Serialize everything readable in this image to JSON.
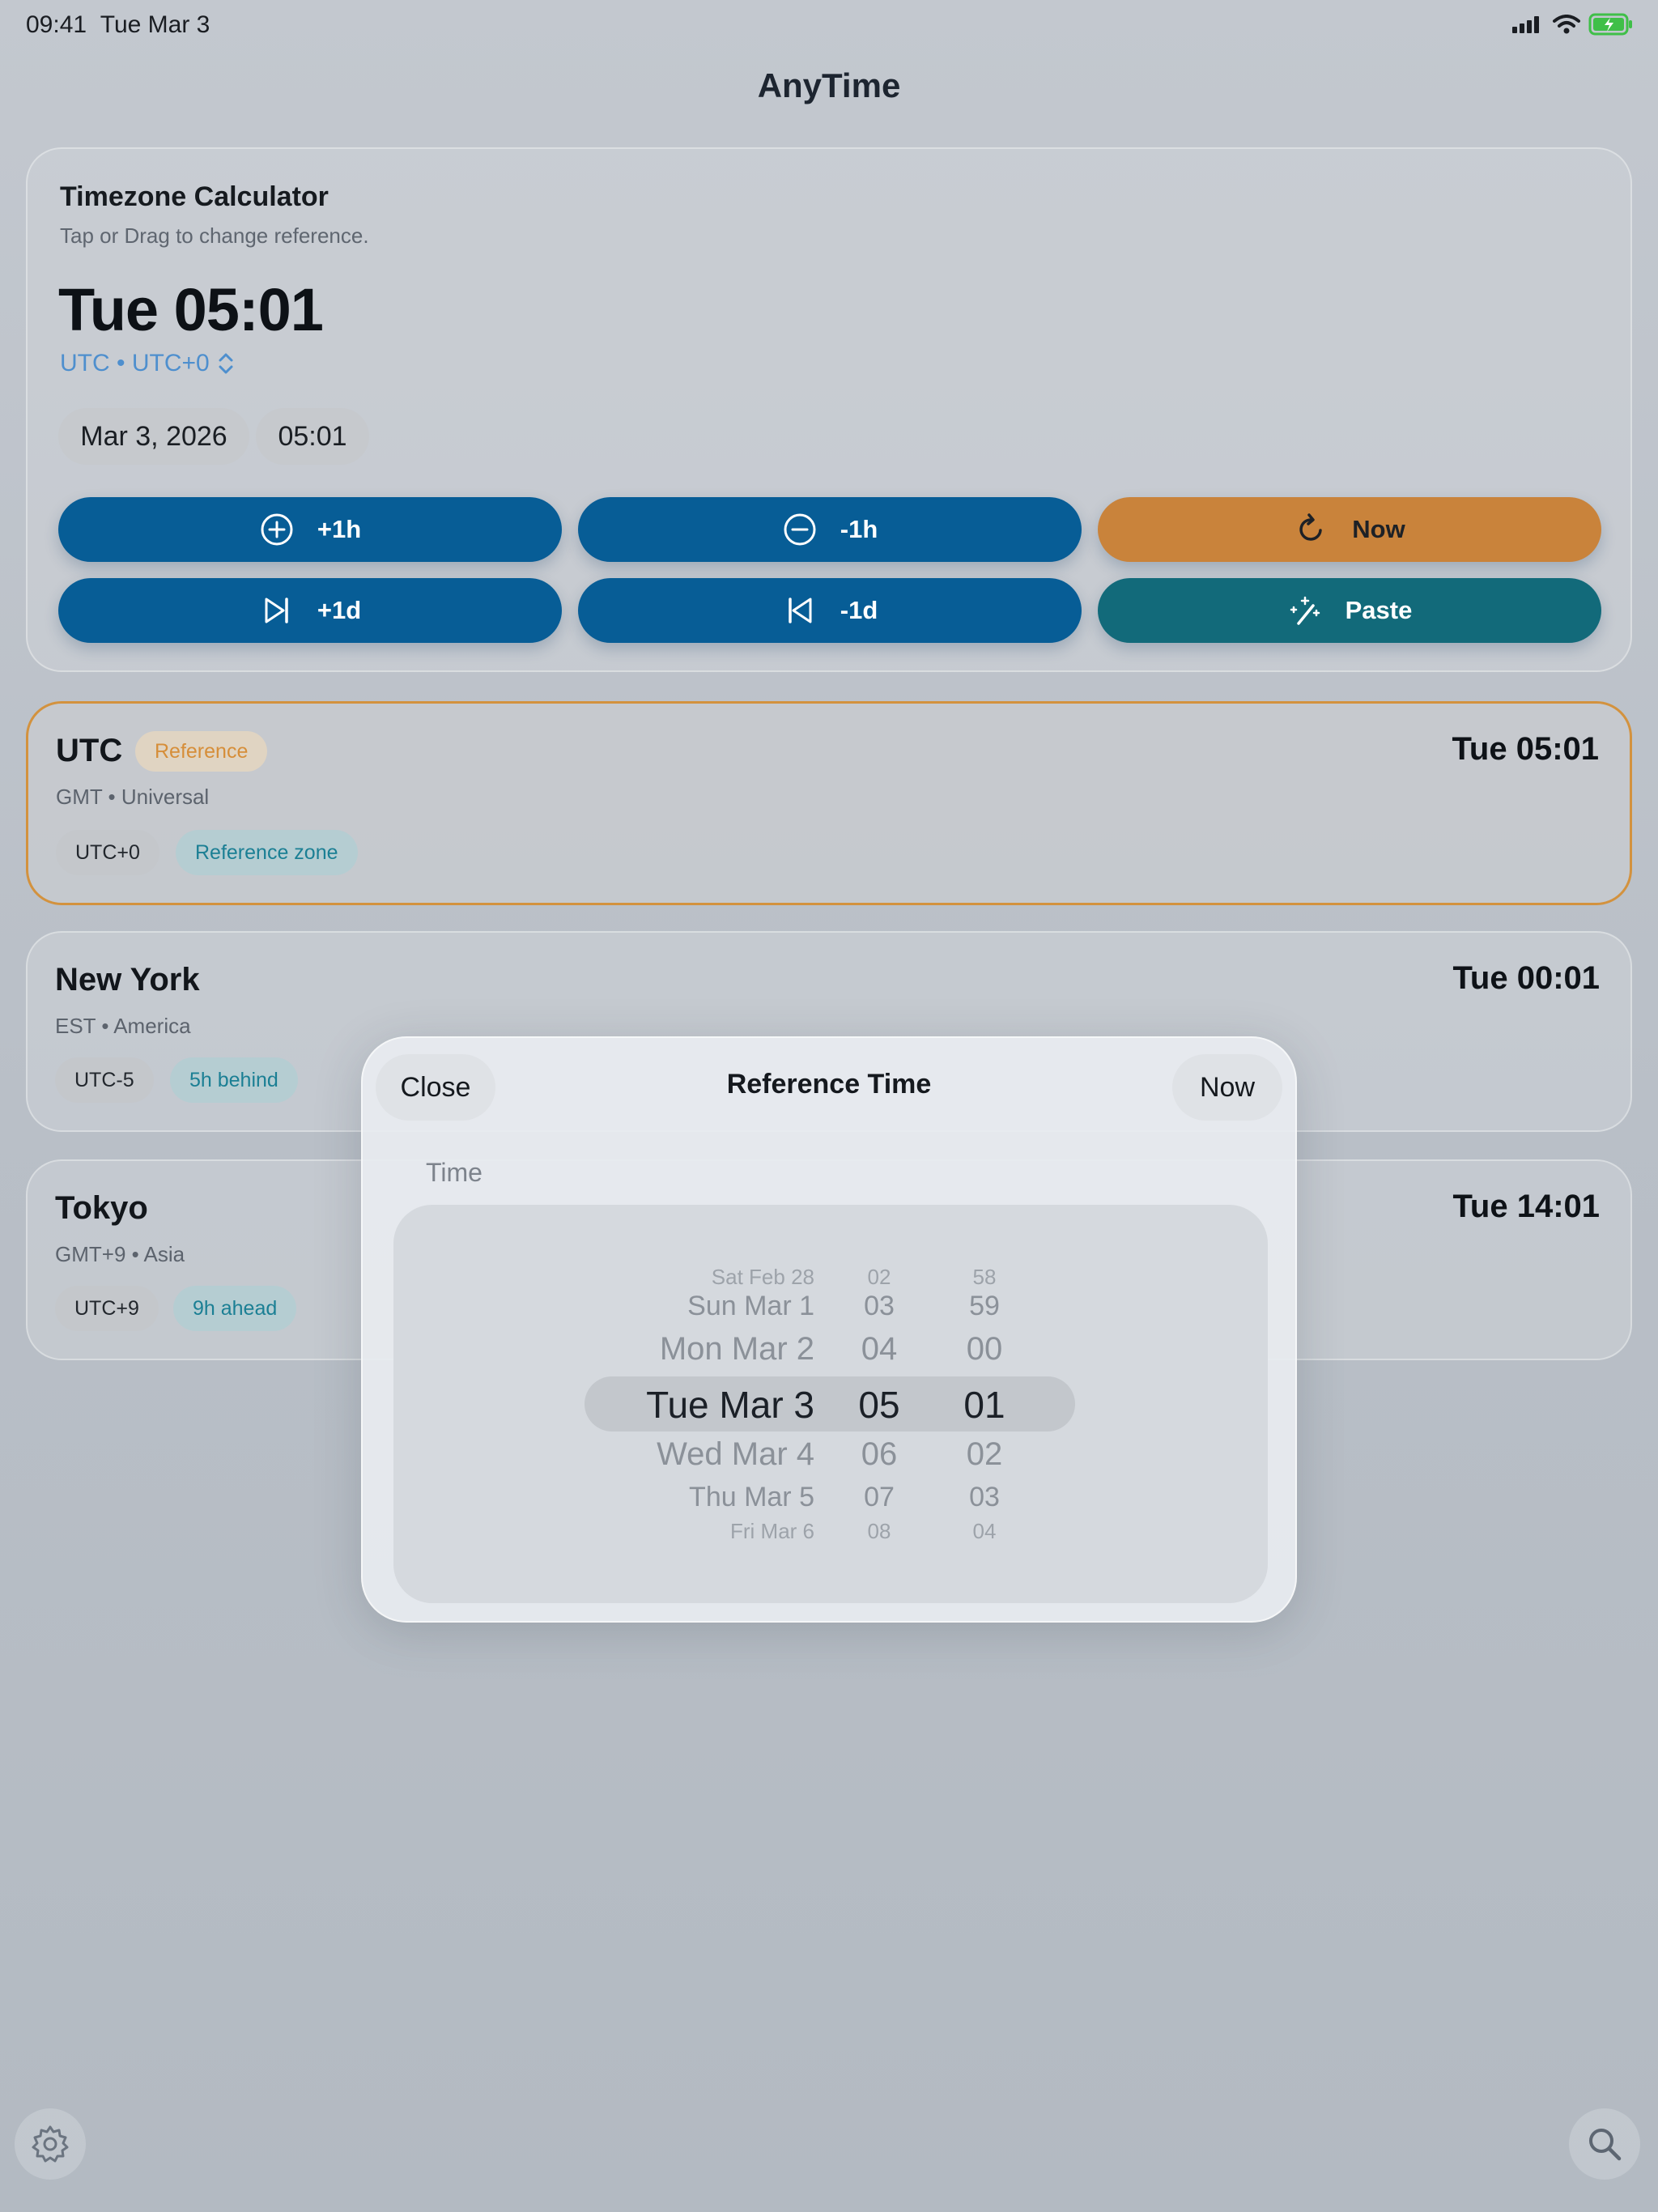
{
  "status_bar": {
    "time": "09:41",
    "date": "Tue Mar 3"
  },
  "app": {
    "title": "AnyTime"
  },
  "calculator": {
    "title": "Timezone Calculator",
    "subtitle": "Tap or Drag to change reference.",
    "big_time": "Tue 05:01",
    "timezone_label": "UTC • UTC+0",
    "date_value": "Mar 3, 2026",
    "time_value": "05:01",
    "buttons": {
      "plus_hour": "+1h",
      "minus_hour": "-1h",
      "now": "Now",
      "plus_day": "+1d",
      "minus_day": "-1d",
      "paste": "Paste"
    }
  },
  "zones": [
    {
      "name": "UTC",
      "badge": "Reference",
      "subtitle": "GMT • Universal",
      "time": "Tue 05:01",
      "offset": "UTC+0",
      "relation": "Reference zone"
    },
    {
      "name": "New York",
      "subtitle": "EST • America",
      "time": "Tue 00:01",
      "offset": "UTC-5",
      "relation": "5h behind"
    },
    {
      "name": "Tokyo",
      "subtitle": "GMT+9 • Asia",
      "time": "Tue 14:01",
      "offset": "UTC+9",
      "relation": "9h ahead"
    }
  ],
  "modal": {
    "title": "Reference Time",
    "close_label": "Close",
    "now_label": "Now",
    "section_label": "Time",
    "picker": {
      "rows": [
        {
          "day": "Sat Feb 28",
          "hour": "02",
          "minute": "58"
        },
        {
          "day": "Sun Mar 1",
          "hour": "03",
          "minute": "59"
        },
        {
          "day": "Mon Mar 2",
          "hour": "04",
          "minute": "00"
        },
        {
          "day": "Tue Mar 3",
          "hour": "05",
          "minute": "01"
        },
        {
          "day": "Wed Mar 4",
          "hour": "06",
          "minute": "02"
        },
        {
          "day": "Thu Mar 5",
          "hour": "07",
          "minute": "03"
        },
        {
          "day": "Fri Mar 6",
          "hour": "08",
          "minute": "04"
        }
      ],
      "selected_index": 3
    }
  },
  "colors": {
    "primary_blue": "#075d96",
    "accent_orange": "#c9833b",
    "teal": "#126a7a",
    "link_blue": "#4e8fce",
    "reference_border": "#d3923e"
  },
  "icons": {
    "plus_hour": "plus-circle-icon",
    "minus_hour": "minus-circle-icon",
    "now": "refresh-icon",
    "plus_day": "skip-forward-icon",
    "minus_day": "skip-back-icon",
    "paste": "magic-wand-icon",
    "settings": "gear-icon",
    "search": "search-icon"
  }
}
